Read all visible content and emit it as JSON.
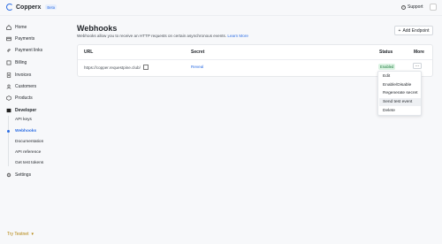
{
  "header": {
    "logo_text": "Copperx",
    "beta_label": "Beta",
    "support_label": "Support"
  },
  "sidebar": {
    "items": [
      {
        "label": "Home",
        "icon": "home-icon"
      },
      {
        "label": "Payments",
        "icon": "payments-icon"
      },
      {
        "label": "Payment links",
        "icon": "link-icon"
      },
      {
        "label": "Billing",
        "icon": "billing-icon"
      },
      {
        "label": "Invoices",
        "icon": "invoice-icon"
      },
      {
        "label": "Customers",
        "icon": "customers-icon"
      },
      {
        "label": "Products",
        "icon": "products-icon"
      },
      {
        "label": "Developer",
        "icon": "developer-icon"
      }
    ],
    "developer_sub": [
      {
        "label": "API keys"
      },
      {
        "label": "Webhooks"
      },
      {
        "label": "Documentation"
      },
      {
        "label": "API reference"
      },
      {
        "label": "Get test tokens"
      }
    ],
    "settings_label": "Settings",
    "testnet_label": "Try Testnet"
  },
  "main": {
    "title": "Webhooks",
    "description": "Webhooks allow you to receive an HTTP requests on certain asynchronous events.",
    "learn_more": "Learn More",
    "add_endpoint_label": "Add Endpoint",
    "table": {
      "headers": {
        "url": "URL",
        "secret": "Secret",
        "status": "Status",
        "more": "More"
      },
      "row": {
        "url": "https://copper.requestpine.club/",
        "secret_action": "Reveal",
        "status": "Enabled",
        "more_symbol": "..."
      }
    },
    "menu": [
      {
        "label": "Edit"
      },
      {
        "label": "Enable/Disable"
      },
      {
        "label": "Regenerate secret"
      },
      {
        "label": "Send test event"
      },
      {
        "label": "Delete"
      }
    ]
  },
  "colors": {
    "accent": "#2f6fe4",
    "enabled_badge_bg": "#dcf3e3",
    "enabled_badge_text": "#1b7a3b",
    "testnet": "#b3850c"
  }
}
